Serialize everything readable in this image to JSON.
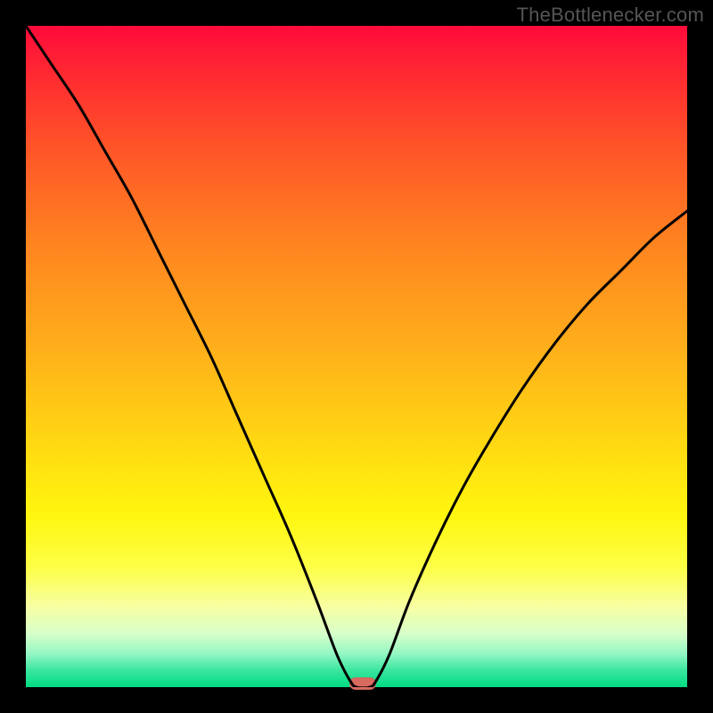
{
  "watermark": "TheBottlenecker.com",
  "colors": {
    "curve": "#000000",
    "marker": "#d86a60",
    "frame": "#000000"
  },
  "chart_data": {
    "type": "line",
    "title": "",
    "xlabel": "",
    "ylabel": "",
    "xlim": [
      0,
      100
    ],
    "ylim": [
      0,
      100
    ],
    "curve": {
      "x": [
        0,
        4,
        8,
        12,
        16,
        20,
        24,
        28,
        32,
        36,
        40,
        44,
        47,
        49,
        50,
        52,
        53,
        55,
        58,
        62,
        66,
        70,
        75,
        80,
        85,
        90,
        95,
        100
      ],
      "y": [
        100,
        94,
        88,
        81,
        74,
        66,
        58,
        50,
        41,
        32,
        23,
        13,
        5,
        1,
        0,
        0,
        1,
        5,
        13,
        22,
        30,
        37,
        45,
        52,
        58,
        63,
        68,
        72
      ]
    },
    "marker": {
      "x": 51,
      "y": 0.5
    },
    "grid": false,
    "legend": null
  }
}
